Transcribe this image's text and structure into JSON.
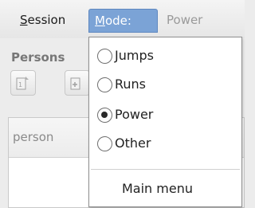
{
  "menubar": {
    "session": {
      "mnemonic": "S",
      "rest": "ession"
    },
    "mode": {
      "mnemonic": "M",
      "rest": "ode:"
    },
    "power_label": "Power"
  },
  "left_panel": {
    "title": "Persons"
  },
  "table": {
    "column_person": "person"
  },
  "dropdown": {
    "options": [
      {
        "label": "Jumps",
        "selected": false
      },
      {
        "label": "Runs",
        "selected": false
      },
      {
        "label": "Power",
        "selected": true
      },
      {
        "label": "Other",
        "selected": false
      }
    ],
    "main_menu_label": "Main menu"
  },
  "colors": {
    "active_menu_bg": "#7ba3d6"
  }
}
